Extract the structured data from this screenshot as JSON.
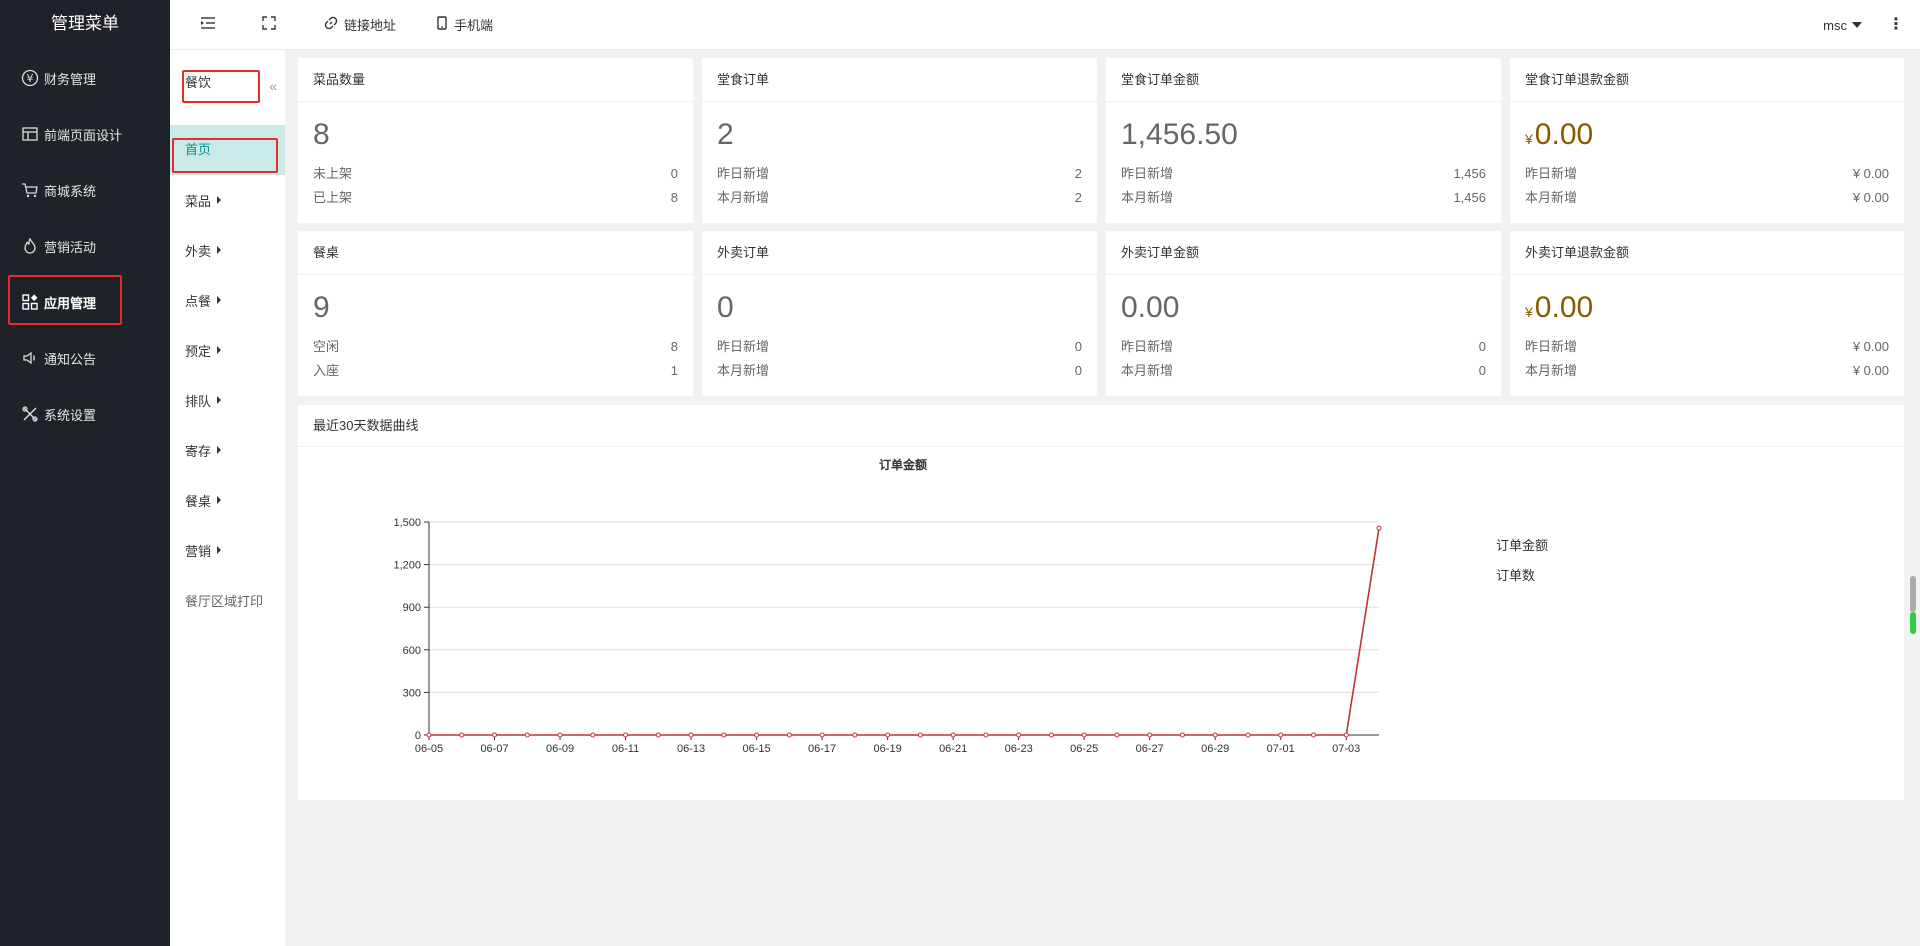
{
  "sidebar": {
    "title": "管理菜单",
    "items": [
      {
        "label": "财务管理",
        "icon": "yen-circle-icon"
      },
      {
        "label": "前端页面设计",
        "icon": "layout-icon"
      },
      {
        "label": "商城系统",
        "icon": "cart-icon"
      },
      {
        "label": "营销活动",
        "icon": "fire-icon"
      },
      {
        "label": "应用管理",
        "icon": "apps-icon"
      },
      {
        "label": "通知公告",
        "icon": "speaker-icon"
      },
      {
        "label": "系统设置",
        "icon": "tools-icon"
      }
    ]
  },
  "topbar": {
    "link_label": "链接地址",
    "mobile_label": "手机端",
    "user": "msc"
  },
  "submenu": {
    "title": "餐饮",
    "collapse": "«",
    "items": [
      {
        "label": "首页"
      },
      {
        "label": "菜品"
      },
      {
        "label": "外卖"
      },
      {
        "label": "点餐"
      },
      {
        "label": "预定"
      },
      {
        "label": "排队"
      },
      {
        "label": "寄存"
      },
      {
        "label": "餐桌"
      },
      {
        "label": "营销"
      },
      {
        "label": "餐厅区域打印"
      }
    ]
  },
  "cards": [
    {
      "title": "菜品数量",
      "value": "8",
      "rows": [
        {
          "label": "未上架",
          "value": "0"
        },
        {
          "label": "已上架",
          "value": "8"
        }
      ]
    },
    {
      "title": "堂食订单",
      "value": "2",
      "rows": [
        {
          "label": "昨日新增",
          "value": "2"
        },
        {
          "label": "本月新增",
          "value": "2"
        }
      ]
    },
    {
      "title": "堂食订单金额",
      "value": "1,456.50",
      "rows": [
        {
          "label": "昨日新增",
          "value": "1,456"
        },
        {
          "label": "本月新增",
          "value": "1,456"
        }
      ]
    },
    {
      "title": "堂食订单退款金额",
      "currency": "¥",
      "value": "0.00",
      "rows": [
        {
          "label": "昨日新增",
          "value": "¥ 0.00"
        },
        {
          "label": "本月新增",
          "value": "¥ 0.00"
        }
      ]
    },
    {
      "title": "餐桌",
      "value": "9",
      "rows": [
        {
          "label": "空闲",
          "value": "8"
        },
        {
          "label": "入座",
          "value": "1"
        }
      ]
    },
    {
      "title": "外卖订单",
      "value": "0",
      "rows": [
        {
          "label": "昨日新增",
          "value": "0"
        },
        {
          "label": "本月新增",
          "value": "0"
        }
      ]
    },
    {
      "title": "外卖订单金额",
      "value": "0.00",
      "rows": [
        {
          "label": "昨日新增",
          "value": "0"
        },
        {
          "label": "本月新增",
          "value": "0"
        }
      ]
    },
    {
      "title": "外卖订单退款金额",
      "currency": "¥",
      "value": "0.00",
      "rows": [
        {
          "label": "昨日新增",
          "value": "¥ 0.00"
        },
        {
          "label": "本月新增",
          "value": "¥ 0.00"
        }
      ]
    }
  ],
  "chart_section": {
    "title": "最近30天数据曲线"
  },
  "colors": {
    "accent": "#009688",
    "line": "#c23531",
    "highlight": "#e52b2b"
  },
  "chart_data": {
    "type": "line",
    "title": "订单金额",
    "ylim": [
      0,
      1500
    ],
    "yticks": [
      "0",
      "300",
      "600",
      "900",
      "1,200",
      "1,500"
    ],
    "xtick_labels": [
      "06-05",
      "06-07",
      "06-09",
      "06-11",
      "06-13",
      "06-15",
      "06-17",
      "06-19",
      "06-21",
      "06-23",
      "06-25",
      "06-27",
      "06-29",
      "07-01",
      "07-03"
    ],
    "categories": [
      "06-05",
      "06-06",
      "06-07",
      "06-08",
      "06-09",
      "06-10",
      "06-11",
      "06-12",
      "06-13",
      "06-14",
      "06-15",
      "06-16",
      "06-17",
      "06-18",
      "06-19",
      "06-20",
      "06-21",
      "06-22",
      "06-23",
      "06-24",
      "06-25",
      "06-26",
      "06-27",
      "06-28",
      "06-29",
      "06-30",
      "07-01",
      "07-02",
      "07-03",
      "07-04"
    ],
    "series": [
      {
        "name": "订单金额",
        "values": [
          0,
          0,
          0,
          0,
          0,
          0,
          0,
          0,
          0,
          0,
          0,
          0,
          0,
          0,
          0,
          0,
          0,
          0,
          0,
          0,
          0,
          0,
          0,
          0,
          0,
          0,
          0,
          0,
          0,
          1456.5
        ]
      }
    ],
    "legend": [
      "订单金额",
      "订单数"
    ],
    "legend_position": "right",
    "grid": true
  }
}
